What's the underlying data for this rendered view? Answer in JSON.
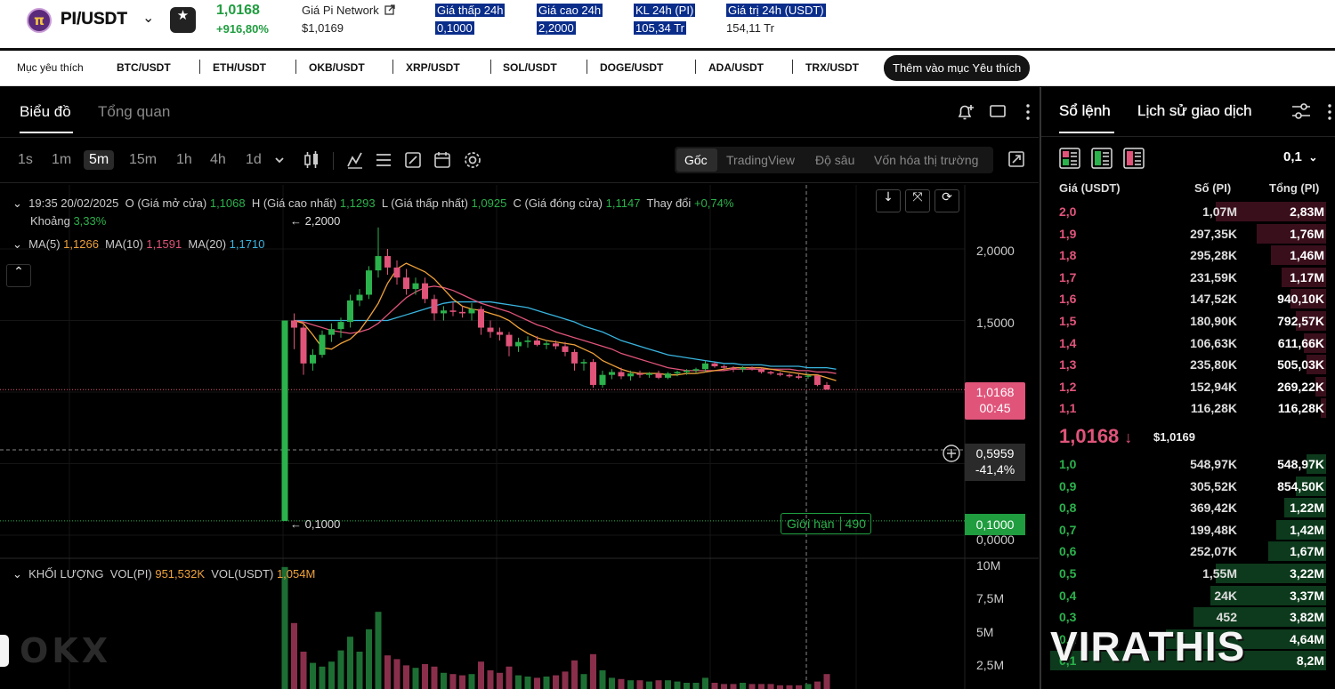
{
  "header": {
    "logo_glyph": "π",
    "pair": "PI/USDT",
    "chevron": "⌄",
    "fav_icon": "★",
    "last_price": "1,0168",
    "change_pct": "+916,80%",
    "index_label": "Giá Pi Network",
    "index_value": "$1,0169",
    "stats": [
      {
        "label": "Giá thấp 24h",
        "value": "0,1000"
      },
      {
        "label": "Giá cao 24h",
        "value": "2,2000"
      },
      {
        "label": "KL 24h (PI)",
        "value": "105,34 Tr"
      },
      {
        "label": "Giá trị 24h (USDT)",
        "value": "154,11 Tr"
      }
    ]
  },
  "favorites": {
    "label": "Mục yêu thích",
    "items": [
      "BTC/USDT",
      "ETH/USDT",
      "OKB/USDT",
      "XRP/USDT",
      "SOL/USDT",
      "DOGE/USDT",
      "ADA/USDT",
      "TRX/USDT"
    ],
    "add_label": "Thêm vào mục Yêu thích"
  },
  "chart_panel": {
    "tabs": [
      "Biểu đồ",
      "Tổng quan"
    ],
    "timeframes": [
      "1s",
      "1m",
      "5m",
      "15m",
      "1h",
      "4h",
      "1d"
    ],
    "active_timeframe": "5m",
    "views": [
      "Gốc",
      "TradingView",
      "Độ sâu",
      "Vốn hóa thị trường"
    ],
    "ohlc": {
      "time": "19:35 20/02/2025",
      "o_label": "O (Giá mở cửa)",
      "o": "1,1068",
      "h_label": "H (Giá cao nhất)",
      "h": "1,1293",
      "l_label": "L (Giá thấp nhất)",
      "l": "1,0925",
      "c_label": "C (Giá đóng cửa)",
      "c": "1,1147",
      "chg_label": "Thay đổi",
      "chg": "+0,74%",
      "range_label": "Khoảng",
      "range": "3,33%"
    },
    "ma": {
      "ma5_label": "MA(5)",
      "ma5": "1,1266",
      "ma10_label": "MA(10)",
      "ma10": "1,1591",
      "ma20_label": "MA(20)",
      "ma20": "1,1710"
    },
    "hi_marker": "← 2,2000",
    "lo_marker": "← 0,1000",
    "y_ticks": [
      "2,0000",
      "1,5000",
      "0,0000"
    ],
    "cur_price_tag": "1,0168",
    "countdown": "00:45",
    "cross_price": "0,5959",
    "cross_pct": "-41,4%",
    "limit_label": "Giới hạn",
    "limit_count": "490",
    "limit_price": "0,1000",
    "volume": {
      "title": "KHỐI LƯỢNG",
      "pi_label": "VOL(PI)",
      "pi": "951,532K",
      "usdt_label": "VOL(USDT)",
      "usdt": "1,054M",
      "y_ticks": [
        "10M",
        "7,5M",
        "5M",
        "2,5M"
      ]
    },
    "colors": {
      "up": "#2bb24c",
      "down": "#e0547a",
      "ma5": "#f0a23a",
      "ma10": "#e0547a",
      "ma20": "#39b5e0"
    }
  },
  "chart_data": {
    "type": "candlestick",
    "interval": "5m",
    "y_range": [
      0,
      2.2
    ],
    "candles": [
      [
        0.1,
        1.5,
        0.1,
        1.5
      ],
      [
        1.5,
        1.55,
        1.3,
        1.45
      ],
      [
        1.45,
        1.48,
        1.12,
        1.2
      ],
      [
        1.2,
        1.3,
        1.15,
        1.26
      ],
      [
        1.26,
        1.43,
        1.24,
        1.4
      ],
      [
        1.4,
        1.48,
        1.35,
        1.44
      ],
      [
        1.44,
        1.52,
        1.38,
        1.49
      ],
      [
        1.49,
        1.68,
        1.45,
        1.64
      ],
      [
        1.64,
        1.72,
        1.6,
        1.68
      ],
      [
        1.68,
        1.88,
        1.65,
        1.85
      ],
      [
        1.85,
        2.15,
        1.8,
        1.95
      ],
      [
        1.95,
        2.0,
        1.82,
        1.87
      ],
      [
        1.87,
        1.92,
        1.75,
        1.8
      ],
      [
        1.8,
        1.86,
        1.68,
        1.72
      ],
      [
        1.72,
        1.8,
        1.68,
        1.76
      ],
      [
        1.76,
        1.8,
        1.62,
        1.65
      ],
      [
        1.65,
        1.68,
        1.5,
        1.55
      ],
      [
        1.55,
        1.6,
        1.5,
        1.57
      ],
      [
        1.57,
        1.63,
        1.53,
        1.56
      ],
      [
        1.56,
        1.6,
        1.52,
        1.55
      ],
      [
        1.55,
        1.62,
        1.5,
        1.58
      ],
      [
        1.58,
        1.6,
        1.4,
        1.45
      ],
      [
        1.45,
        1.5,
        1.38,
        1.42
      ],
      [
        1.42,
        1.45,
        1.36,
        1.4
      ],
      [
        1.4,
        1.42,
        1.25,
        1.32
      ],
      [
        1.32,
        1.38,
        1.28,
        1.35
      ],
      [
        1.35,
        1.39,
        1.31,
        1.36
      ],
      [
        1.36,
        1.39,
        1.32,
        1.33
      ],
      [
        1.33,
        1.36,
        1.3,
        1.34
      ],
      [
        1.34,
        1.36,
        1.3,
        1.32
      ],
      [
        1.32,
        1.35,
        1.25,
        1.28
      ],
      [
        1.28,
        1.3,
        1.15,
        1.2
      ],
      [
        1.2,
        1.23,
        1.15,
        1.21
      ],
      [
        1.21,
        1.23,
        1.03,
        1.05
      ],
      [
        1.05,
        1.15,
        1.03,
        1.12
      ],
      [
        1.12,
        1.16,
        1.09,
        1.14
      ],
      [
        1.14,
        1.17,
        1.09,
        1.11
      ],
      [
        1.11,
        1.15,
        1.08,
        1.13
      ],
      [
        1.13,
        1.15,
        1.1,
        1.12
      ],
      [
        1.12,
        1.14,
        1.1,
        1.13
      ],
      [
        1.13,
        1.15,
        1.09,
        1.1
      ],
      [
        1.1,
        1.14,
        1.09,
        1.13
      ],
      [
        1.13,
        1.15,
        1.11,
        1.14
      ],
      [
        1.14,
        1.16,
        1.12,
        1.15
      ],
      [
        1.15,
        1.17,
        1.13,
        1.16
      ],
      [
        1.16,
        1.22,
        1.14,
        1.2
      ],
      [
        1.2,
        1.21,
        1.17,
        1.18
      ],
      [
        1.18,
        1.19,
        1.15,
        1.17
      ],
      [
        1.17,
        1.18,
        1.14,
        1.16
      ],
      [
        1.16,
        1.18,
        1.14,
        1.17
      ],
      [
        1.17,
        1.18,
        1.15,
        1.16
      ],
      [
        1.16,
        1.17,
        1.13,
        1.14
      ],
      [
        1.14,
        1.15,
        1.12,
        1.13
      ],
      [
        1.13,
        1.14,
        1.11,
        1.12
      ],
      [
        1.12,
        1.13,
        1.1,
        1.11
      ],
      [
        1.11,
        1.13,
        1.09,
        1.1
      ],
      [
        1.1068,
        1.1293,
        1.0925,
        1.1147
      ],
      [
        1.1147,
        1.12,
        1.04,
        1.05
      ],
      [
        1.05,
        1.07,
        1.0168,
        1.0168
      ]
    ],
    "ma5": [
      1.5,
      1.48,
      1.4,
      1.31,
      1.3,
      1.34,
      1.37,
      1.43,
      1.52,
      1.62,
      1.76,
      1.86,
      1.9,
      1.87,
      1.84,
      1.79,
      1.72,
      1.65,
      1.6,
      1.58,
      1.57,
      1.55,
      1.53,
      1.5,
      1.45,
      1.41,
      1.38,
      1.36,
      1.35,
      1.34,
      1.33,
      1.3,
      1.27,
      1.22,
      1.19,
      1.16,
      1.14,
      1.13,
      1.13,
      1.13,
      1.12,
      1.12,
      1.13,
      1.13,
      1.14,
      1.15,
      1.16,
      1.17,
      1.17,
      1.17,
      1.17,
      1.16,
      1.15,
      1.14,
      1.13,
      1.12,
      1.12,
      1.1,
      1.08
    ],
    "ma10": [
      1.5,
      1.49,
      1.47,
      1.45,
      1.43,
      1.42,
      1.41,
      1.42,
      1.44,
      1.48,
      1.54,
      1.6,
      1.66,
      1.7,
      1.73,
      1.74,
      1.73,
      1.71,
      1.68,
      1.65,
      1.62,
      1.6,
      1.58,
      1.56,
      1.53,
      1.5,
      1.47,
      1.45,
      1.42,
      1.4,
      1.38,
      1.36,
      1.34,
      1.32,
      1.3,
      1.27,
      1.25,
      1.23,
      1.21,
      1.19,
      1.17,
      1.16,
      1.15,
      1.15,
      1.15,
      1.15,
      1.15,
      1.16,
      1.16,
      1.16,
      1.16,
      1.16,
      1.16,
      1.16,
      1.15,
      1.15,
      1.14,
      1.14,
      1.13
    ],
    "ma20": [
      1.5,
      1.5,
      1.5,
      1.5,
      1.5,
      1.5,
      1.5,
      1.5,
      1.5,
      1.5,
      1.5,
      1.52,
      1.54,
      1.56,
      1.58,
      1.6,
      1.62,
      1.63,
      1.63,
      1.63,
      1.63,
      1.63,
      1.62,
      1.61,
      1.6,
      1.59,
      1.57,
      1.55,
      1.53,
      1.51,
      1.49,
      1.46,
      1.44,
      1.42,
      1.39,
      1.36,
      1.34,
      1.32,
      1.3,
      1.28,
      1.26,
      1.25,
      1.24,
      1.23,
      1.22,
      1.21,
      1.2,
      1.2,
      1.19,
      1.19,
      1.19,
      1.18,
      1.18,
      1.18,
      1.18,
      1.17,
      1.17,
      1.17,
      1.16
    ],
    "volume_range": [
      0,
      10000000
    ],
    "volume": [
      9800000,
      5300000,
      3000000,
      2100000,
      1800000,
      2200000,
      3100000,
      4200000,
      3000000,
      4800000,
      6200000,
      2700000,
      2400000,
      1900000,
      1700000,
      2000000,
      1800000,
      1300000,
      1200000,
      1100000,
      1200000,
      2200000,
      1500000,
      1300000,
      1800000,
      1100000,
      1000000,
      900000,
      1000000,
      1100000,
      1400000,
      2300000,
      1200000,
      2800000,
      1500000,
      900000,
      800000,
      700000,
      700000,
      600000,
      700000,
      700000,
      600000,
      500000,
      500000,
      900000,
      500000,
      400000,
      400000,
      500000,
      400000,
      400000,
      400000,
      300000,
      300000,
      300000,
      400000,
      600000,
      1200000
    ]
  },
  "orderbook": {
    "tabs": [
      "Sổ lệnh",
      "Lịch sử giao dịch"
    ],
    "tick_size": "0,1",
    "headers": {
      "price": "Giá (USDT)",
      "size": "Số (PI)",
      "total": "Tổng (PI)"
    },
    "asks": [
      {
        "price": "2,0",
        "size": "1,07M",
        "total": "2,83M",
        "depth": 0.4
      },
      {
        "price": "1,9",
        "size": "297,35K",
        "total": "1,76M",
        "depth": 0.25
      },
      {
        "price": "1,8",
        "size": "295,28K",
        "total": "1,46M",
        "depth": 0.2
      },
      {
        "price": "1,7",
        "size": "231,59K",
        "total": "1,17M",
        "depth": 0.16
      },
      {
        "price": "1,6",
        "size": "147,52K",
        "total": "940,10K",
        "depth": 0.13
      },
      {
        "price": "1,5",
        "size": "180,90K",
        "total": "792,57K",
        "depth": 0.11
      },
      {
        "price": "1,4",
        "size": "106,63K",
        "total": "611,66K",
        "depth": 0.08
      },
      {
        "price": "1,3",
        "size": "235,80K",
        "total": "505,03K",
        "depth": 0.07
      },
      {
        "price": "1,2",
        "size": "152,94K",
        "total": "269,22K",
        "depth": 0.04
      },
      {
        "price": "1,1",
        "size": "116,28K",
        "total": "116,28K",
        "depth": 0.02
      }
    ],
    "mid_price": "1,0168",
    "mid_arrow": "↓",
    "mid_usd": "$1,0169",
    "bids": [
      {
        "price": "1,0",
        "size": "548,97K",
        "total": "548,97K",
        "depth": 0.07
      },
      {
        "price": "0,9",
        "size": "305,52K",
        "total": "854,50K",
        "depth": 0.11
      },
      {
        "price": "0,8",
        "size": "369,42K",
        "total": "1,22M",
        "depth": 0.15
      },
      {
        "price": "0,7",
        "size": "199,48K",
        "total": "1,42M",
        "depth": 0.18
      },
      {
        "price": "0,6",
        "size": "252,07K",
        "total": "1,67M",
        "depth": 0.21
      },
      {
        "price": "0,5",
        "size": "1,55M",
        "total": "3,22M",
        "depth": 0.4
      },
      {
        "price": "0,4",
        "size": "24K",
        "total": "3,37M",
        "depth": 0.42
      },
      {
        "price": "0,3",
        "size": "452",
        "total": "3,82M",
        "depth": 0.48
      },
      {
        "price": "0,2",
        "size": "",
        "total": "4,64M",
        "depth": 0.58
      },
      {
        "price": "0,1",
        "size": "",
        "total": "8,2M",
        "depth": 1.0
      }
    ],
    "watermark": "VIRATHIS",
    "brand_mark": "OKX"
  }
}
